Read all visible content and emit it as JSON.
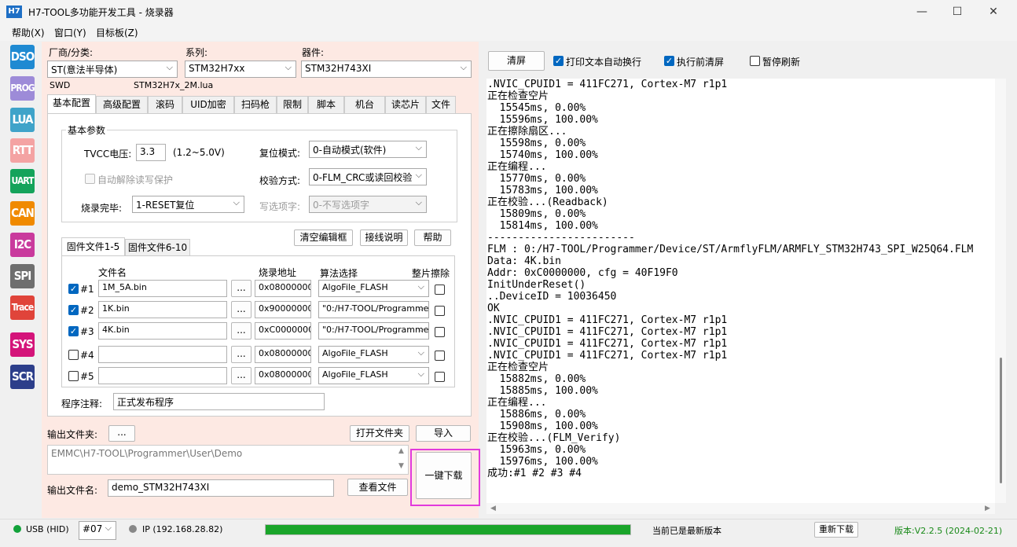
{
  "window": {
    "icon": "H7",
    "title": "H7-TOOL多功能开发工具 - 烧录器",
    "min": "—",
    "max": "☐",
    "close": "✕"
  },
  "menu": [
    "帮助(X)",
    "窗口(Y)",
    "目标板(Z)"
  ],
  "tools": [
    {
      "label": "DSO",
      "color": "#1f8ad2"
    },
    {
      "label": "PROG",
      "color": "#9d8bd8"
    },
    {
      "label": "LUA",
      "color": "#3fa3c9"
    },
    {
      "label": "RTT",
      "color": "#f4a3a3"
    },
    {
      "label": "UART",
      "color": "#14a35b"
    },
    {
      "label": "CAN",
      "color": "#f08a00"
    },
    {
      "label": "I2C",
      "color": "#c93a9d"
    },
    {
      "label": "SPI",
      "color": "#6e6e6e"
    },
    {
      "label": "Trace",
      "color": "#e0443a"
    },
    {
      "label": "SYS",
      "color": "#d4147a"
    },
    {
      "label": "SCR",
      "color": "#2c3e8a"
    }
  ],
  "device": {
    "vendor_label": "厂商/分类:",
    "vendor": "ST(意法半导体)",
    "series_label": "系列:",
    "series": "STM32H7xx",
    "part_label": "器件:",
    "part": "STM32H743XI",
    "iface": "SWD",
    "lua": "STM32H7x_2M.lua"
  },
  "tabs": [
    "基本配置",
    "高级配置",
    "滚码",
    "UID加密",
    "扫码枪",
    "限制",
    "脚本",
    "机台",
    "读芯片",
    "文件"
  ],
  "basic": {
    "group": "基本参数",
    "tvcc_label": "TVCC电压:",
    "tvcc": "3.3",
    "tvcc_range": "(1.2~5.0V)",
    "reset_label": "复位模式:",
    "reset": "0-自动模式(软件)",
    "auto_unlock": "自动解除读写保护",
    "verify_label": "校验方式:",
    "verify": "0-FLM_CRC或读回校验",
    "done_label": "烧录完毕:",
    "done": "1-RESET复位",
    "opt_label": "写选项字:",
    "opt": "0-不写选项字"
  },
  "buttons": {
    "clear_cfg": "清空编辑框",
    "wiring": "接线说明",
    "help": "帮助",
    "open_folder": "打开文件夹",
    "import": "导入",
    "browse": "...",
    "view_file": "查看文件",
    "download": "一键下载",
    "clear_log": "清屏",
    "redownload": "重新下载"
  },
  "files": {
    "tab1": "固件文件1-5",
    "tab2": "固件文件6-10",
    "col_name": "文件名",
    "col_addr": "烧录地址",
    "col_algo": "算法选择",
    "col_erase": "整片擦除",
    "rows": [
      {
        "idx": "#1",
        "checked": true,
        "name": "1M_5A.bin",
        "addr": "0x08000000",
        "algo": "AlgoFile_FLASH"
      },
      {
        "idx": "#2",
        "checked": true,
        "name": "1K.bin",
        "addr": "0x90000000",
        "algo": "\"0:/H7-TOOL/Programme"
      },
      {
        "idx": "#3",
        "checked": true,
        "name": "4K.bin",
        "addr": "0xC0000000",
        "algo": "\"0:/H7-TOOL/Programme"
      },
      {
        "idx": "#4",
        "checked": false,
        "name": "",
        "addr": "0x08000000",
        "algo": "AlgoFile_FLASH"
      },
      {
        "idx": "#5",
        "checked": false,
        "name": "",
        "addr": "0x08000000",
        "algo": "AlgoFile_FLASH"
      }
    ]
  },
  "comment_label": "程序注释:",
  "comment": "正式发布程序",
  "output": {
    "folder_label": "输出文件夹:",
    "path": "EMMC\\H7-TOOL\\Programmer\\User\\Demo",
    "name_label": "输出文件名:",
    "name": "demo_STM32H743XI"
  },
  "options": {
    "wrap": "打印文本自动换行",
    "clear_before": "执行前清屏",
    "pause": "暂停刷新"
  },
  "log": [
    ".NVIC_CPUID1 = 411FC271, Cortex-M7 r1p1",
    "正在检查空片",
    "  15545ms, 0.00%",
    "  15596ms, 100.00%",
    "正在擦除扇区...",
    "  15598ms, 0.00%",
    "  15740ms, 100.00%",
    "正在编程...",
    "  15770ms, 0.00%",
    "  15783ms, 100.00%",
    "正在校验...(Readback)",
    "  15809ms, 0.00%",
    "  15814ms, 100.00%",
    "------------------------",
    "FLM : 0:/H7-TOOL/Programmer/Device/ST/ArmflyFLM/ARMFLY_STM32H743_SPI_W25Q64.FLM",
    "Data: 4K.bin",
    "Addr: 0xC0000000, cfg = 40F19F0",
    "InitUnderReset()",
    "..DeviceID = 10036450",
    "OK",
    ".NVIC_CPUID1 = 411FC271, Cortex-M7 r1p1",
    ".NVIC_CPUID1 = 411FC271, Cortex-M7 r1p1",
    ".NVIC_CPUID1 = 411FC271, Cortex-M7 r1p1",
    ".NVIC_CPUID1 = 411FC271, Cortex-M7 r1p1",
    "正在检查空片",
    "  15882ms, 0.00%",
    "  15885ms, 100.00%",
    "正在编程...",
    "  15886ms, 0.00%",
    "  15908ms, 100.00%",
    "正在校验...(FLM_Verify)",
    "  15963ms, 0.00%",
    "  15976ms, 100.00%",
    "成功:#1 #2 #3 #4"
  ],
  "status": {
    "usb": "USB (HID)",
    "port": "#07",
    "ip": "IP (192.168.28.82)",
    "progress": 1.0,
    "msg": "当前已是最新版本",
    "version": "版本:V2.2.5 (2024-02-21)"
  }
}
